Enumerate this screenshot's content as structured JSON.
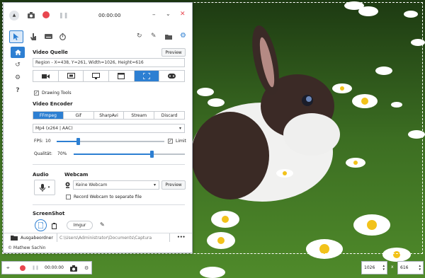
{
  "titlebar": {
    "timer": "00:00:00"
  },
  "video_source": {
    "heading": "Video Quelle",
    "preview_label": "Preview",
    "region_text": "Region - X=438, Y=261, Width=1026, Height=616",
    "drawing_tools_label": "Drawing Tools"
  },
  "video_encoder": {
    "heading": "Video Encoder",
    "tabs": [
      "FFmpeg",
      "Gif",
      "SharpAvi",
      "Stream",
      "Discard"
    ],
    "codec": "Mp4 (x264 | AAC)",
    "fps_label": "FPS:",
    "fps_value": "10",
    "fps_level": 0.2,
    "limit_label": "Limit",
    "quality_label": "Qualität:",
    "quality_value": "70%",
    "quality_level": 0.7
  },
  "audio": {
    "heading": "Audio"
  },
  "webcam": {
    "heading": "Webcam",
    "selected": "Keine Webcam",
    "preview_label": "Preview",
    "record_separate_label": "Record Webcam to separate file"
  },
  "screenshot": {
    "heading": "ScreenShot",
    "imgur_label": "Imgur"
  },
  "output": {
    "folder_label": "Ausgabeordner",
    "path": "C:\\Users\\Administrator\\Documents\\Captura",
    "more_label": "•••"
  },
  "footer": {
    "copyright": "© Mathew Sachin"
  },
  "mini_bar": {
    "timer": "00:00:00"
  },
  "dimensions": {
    "width": "1026",
    "x_label": "x",
    "height": "616"
  },
  "colors": {
    "accent": "#2d7fd2",
    "record": "#e8464f"
  }
}
